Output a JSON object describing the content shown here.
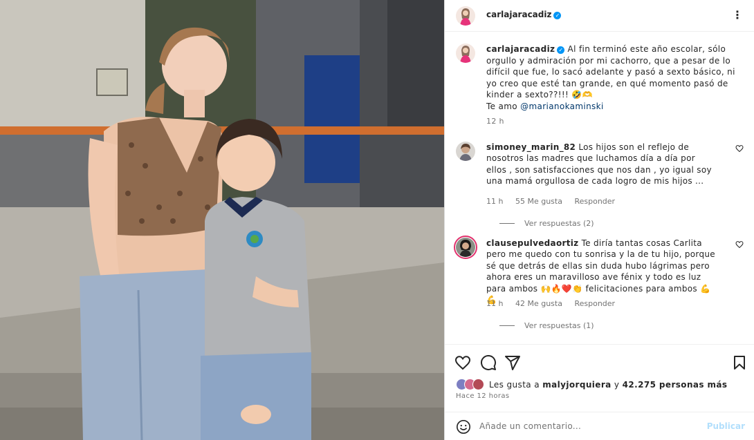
{
  "post": {
    "username": "carlajaracadiz",
    "verified": true,
    "more_icon": "more-horizontal-icon"
  },
  "caption": {
    "username": "carlajaracadiz",
    "text": "Al fin terminó este año escolar, sólo orgullo y admiración por mi cachorro, que a pesar de lo difícil que fue, lo sacó adelante y pasó a sexto básico, ni yo creo que esté tan grande, en qué momento pasó de kinder a sexto??!!! 🤣🫶",
    "love_prefix": "Te amo",
    "mention": "@marianokaminski",
    "time": "12 h"
  },
  "comments": [
    {
      "username": "simoney_marin_82",
      "text": "Los hijos son el reflejo de nosotros las madres que luchamos día a día por ellos , son satisfacciones que nos dan , yo igual soy una mamá orgullosa de cada logro de mis hijos ...",
      "time": "11 h",
      "likes": "55 Me gusta",
      "reply": "Responder",
      "view_replies": "Ver respuestas (2)"
    },
    {
      "username": "clausepulvedaortiz",
      "text": "Te diría tantas cosas Carlita pero me quedo con tu sonrisa y la de tu hijo, porque sé que detrás de ellas sin duda hubo lágrimas pero ahora eres un maravilloso ave fénix y todo es luz para ambos 🙌🔥❤️👏 felicitaciones para ambos 💪💪",
      "time": "11 h",
      "likes": "42 Me gusta",
      "reply": "Responder",
      "view_replies": "Ver respuestas (1)"
    }
  ],
  "actions": {
    "like_icon": "heart-icon",
    "comment_icon": "comment-icon",
    "share_icon": "send-icon",
    "save_icon": "bookmark-icon"
  },
  "likes": {
    "prefix": "Les gusta a",
    "user": "malyjorquiera",
    "connector": "y",
    "count": "42.275 personas más"
  },
  "timestamp": "Hace 12 horas",
  "add_comment": {
    "placeholder": "Añade un comentario...",
    "post_label": "Publicar",
    "emoji_icon": "emoji-icon"
  }
}
